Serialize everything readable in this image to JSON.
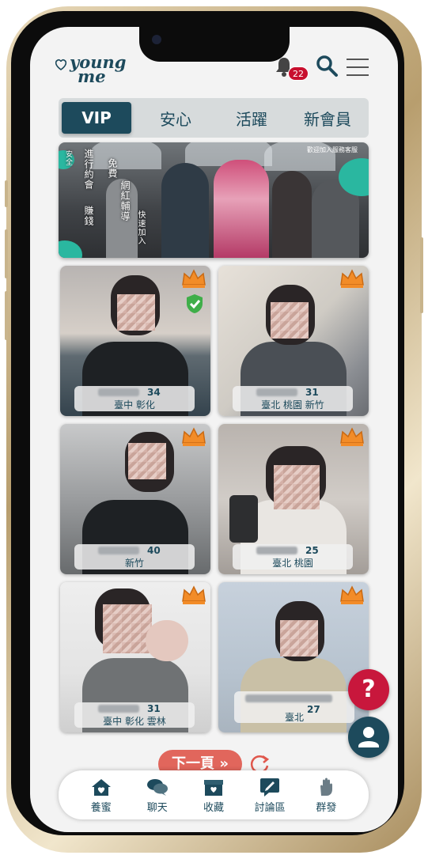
{
  "header": {
    "logo_line1": "young",
    "logo_line2": "me",
    "notification_count": "22"
  },
  "tabs": [
    {
      "label": "VIP",
      "active": true
    },
    {
      "label": "安心",
      "active": false
    },
    {
      "label": "活躍",
      "active": false
    },
    {
      "label": "新會員",
      "active": false
    }
  ],
  "banner": {
    "text_col1": "進行約會",
    "text_col2": "賺錢",
    "text_col3": "免費",
    "text_col4": "網紅輔導",
    "text_col5": "快速加入",
    "text_small": "安全",
    "service": "歡迎加入服務客服"
  },
  "profiles": [
    {
      "age": "34",
      "location": "臺中 彰化",
      "verified": true
    },
    {
      "age": "31",
      "location": "臺北 桃園 新竹",
      "verified": false
    },
    {
      "age": "40",
      "location": "新竹",
      "verified": false
    },
    {
      "age": "25",
      "location": "臺北 桃園",
      "verified": false
    },
    {
      "age": "31",
      "location": "臺中 彰化 雲林",
      "verified": false
    },
    {
      "age": "27",
      "location": "臺北",
      "verified": false
    }
  ],
  "pagination": {
    "next_label": "下一頁 »"
  },
  "fab": {
    "help": "?"
  },
  "nav": [
    {
      "label": "養蜜",
      "icon": "home-heart-icon"
    },
    {
      "label": "聊天",
      "icon": "chat-icon"
    },
    {
      "label": "收藏",
      "icon": "favorites-box-icon"
    },
    {
      "label": "討論區",
      "icon": "forum-icon"
    },
    {
      "label": "群發",
      "icon": "broadcast-hand-icon"
    }
  ],
  "colors": {
    "primary": "#1d4a5c",
    "accent": "#c8173c",
    "next": "#e0574c",
    "crown": "#f28c28"
  }
}
